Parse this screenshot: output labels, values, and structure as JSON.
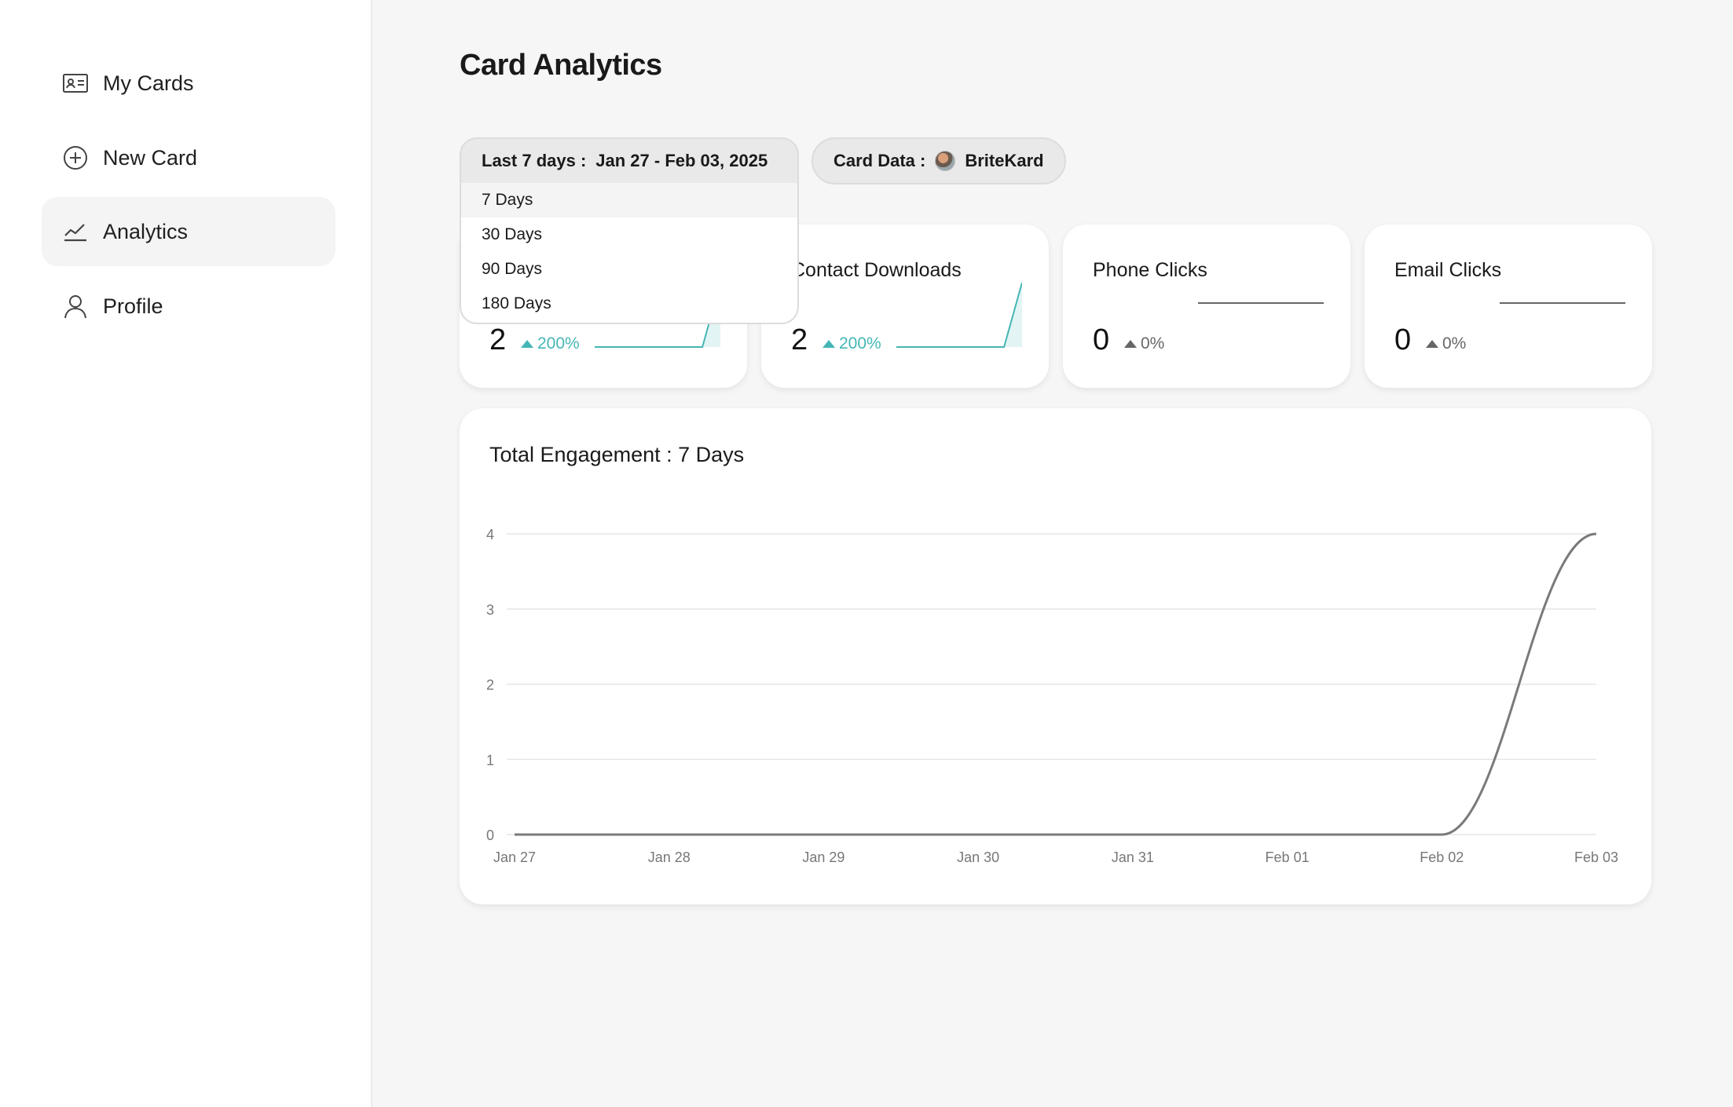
{
  "sidebar": {
    "items": [
      {
        "label": "My Cards",
        "icon": "contact-card-icon",
        "active": false
      },
      {
        "label": "New Card",
        "icon": "plus-circle-icon",
        "active": false
      },
      {
        "label": "Analytics",
        "icon": "trend-line-icon",
        "active": true
      },
      {
        "label": "Profile",
        "icon": "user-icon",
        "active": false
      }
    ]
  },
  "page": {
    "title": "Card Analytics"
  },
  "filters": {
    "date_label": "Last 7 days :",
    "date_range": "Jan 27 - Feb 03, 2025",
    "card_label": "Card Data :",
    "card_name": "BriteKard"
  },
  "dropdown": {
    "options": [
      "7 Days",
      "30 Days",
      "90 Days",
      "180 Days"
    ],
    "selected": "7 Days"
  },
  "stats": [
    {
      "title": "",
      "value": "2",
      "change": "200%",
      "trend": "up",
      "spark": [
        0,
        0,
        0,
        0,
        0,
        0,
        0,
        2
      ]
    },
    {
      "title": "Contact Downloads",
      "value": "2",
      "change": "200%",
      "trend": "up",
      "spark": [
        0,
        0,
        0,
        0,
        0,
        0,
        0,
        2
      ]
    },
    {
      "title": "Phone Clicks",
      "value": "0",
      "change": "0%",
      "trend": "flat",
      "spark": [
        0,
        0,
        0,
        0,
        0,
        0,
        0,
        0
      ]
    },
    {
      "title": "Email Clicks",
      "value": "0",
      "change": "0%",
      "trend": "flat",
      "spark": [
        0,
        0,
        0,
        0,
        0,
        0,
        0,
        0
      ]
    }
  ],
  "colors": {
    "up": "#45b6b6",
    "flat": "#666666",
    "line": "#7a7a7a",
    "grid": "#e6e6e6"
  },
  "engagement": {
    "title": "Total Engagement : 7 Days"
  },
  "chart_data": {
    "type": "line",
    "title": "Total Engagement : 7 Days",
    "xlabel": "",
    "ylabel": "",
    "categories": [
      "Jan 27",
      "Jan 28",
      "Jan 29",
      "Jan 30",
      "Jan 31",
      "Feb 01",
      "Feb 02",
      "Feb 03"
    ],
    "values": [
      0,
      0,
      0,
      0,
      0,
      0,
      0,
      4
    ],
    "ylim": [
      0,
      4
    ],
    "yticks": [
      0,
      1,
      2,
      3,
      4
    ],
    "grid": true
  }
}
